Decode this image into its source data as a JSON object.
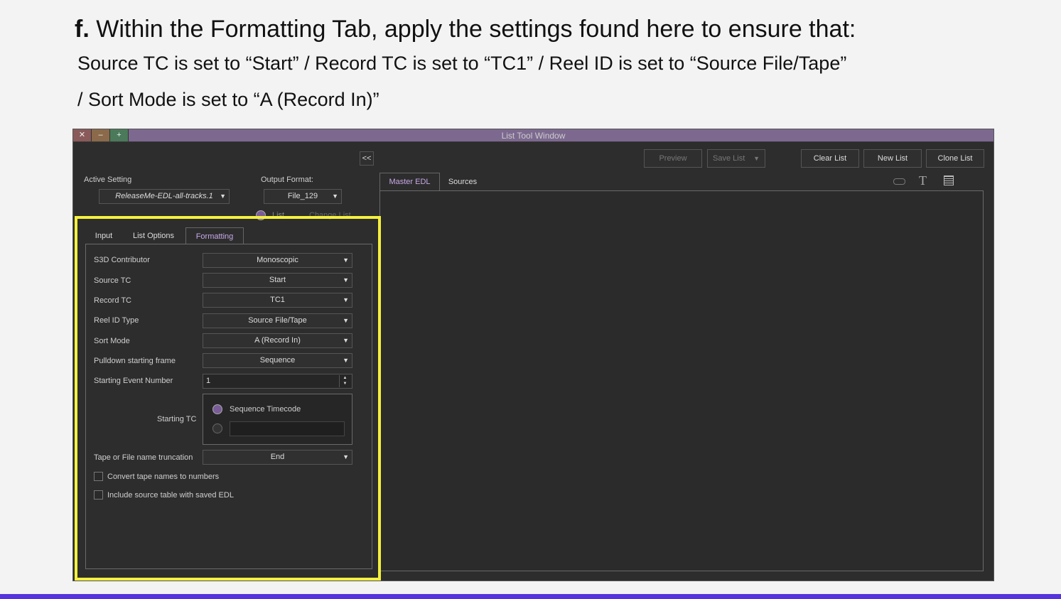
{
  "slide": {
    "title_prefix": "f.",
    "title": "Within the Formatting Tab, apply the settings found here to ensure that:",
    "line1": "Source TC is set to “Start”  /  Record TC is set to “TC1”  /  Reel ID is set to “Source File/Tape”",
    "line2": "/  Sort Mode is set to “A (Record In)”"
  },
  "window": {
    "title": "List Tool Window",
    "close": "✕",
    "minimize": "–",
    "maximize": "+",
    "collapse": "<<",
    "toolbar": {
      "preview": "Preview",
      "save_list": "Save List",
      "clear_list": "Clear List",
      "new_list": "New List",
      "clone_list": "Clone List"
    },
    "active_setting_label": "Active Setting",
    "active_setting_value": "ReleaseMe-EDL-all-tracks.1",
    "output_format_label": "Output Format:",
    "output_format_value": "File_129",
    "list_radio": "List",
    "change_list": "Change List",
    "tabs": {
      "input": "Input",
      "list_options": "List Options",
      "formatting": "Formatting"
    },
    "right_tabs": {
      "master_edl": "Master EDL",
      "sources": "Sources"
    },
    "formatting": {
      "s3d_label": "S3D Contributor",
      "s3d_value": "Monoscopic",
      "source_tc_label": "Source TC",
      "source_tc_value": "Start",
      "record_tc_label": "Record TC",
      "record_tc_value": "TC1",
      "reel_id_label": "Reel ID Type",
      "reel_id_value": "Source File/Tape",
      "sort_mode_label": "Sort Mode",
      "sort_mode_value": "A (Record In)",
      "pulldown_label": "Pulldown starting frame",
      "pulldown_value": "Sequence",
      "start_event_label": "Starting Event Number",
      "start_event_value": "1",
      "starting_tc_label": "Starting TC",
      "sequence_timecode": "Sequence Timecode",
      "truncation_label": "Tape or File name truncation",
      "truncation_value": "End",
      "convert_tape": "Convert tape names to numbers",
      "include_source": "Include source table with saved EDL"
    }
  }
}
